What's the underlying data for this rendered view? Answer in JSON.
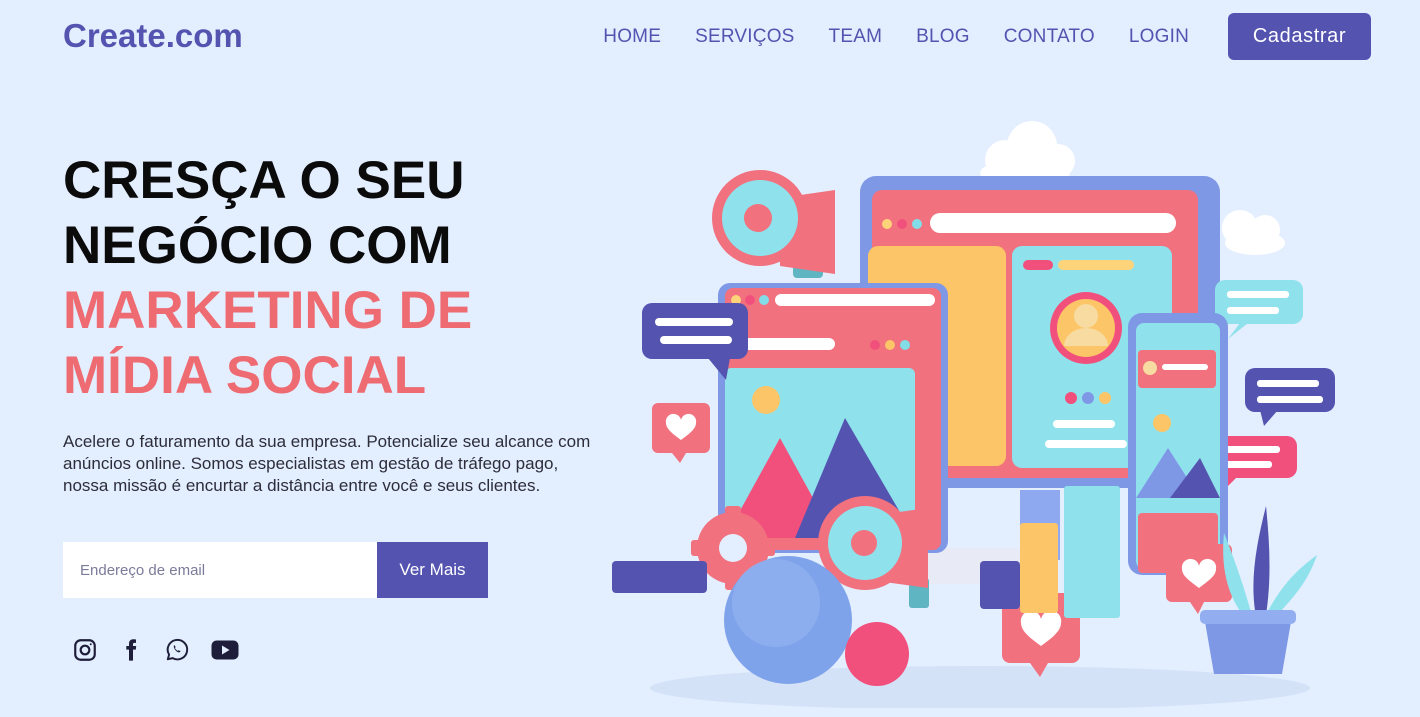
{
  "brand": {
    "logo": "Create.com"
  },
  "nav": {
    "items": [
      "HOME",
      "SERVIÇOS",
      "TEAM",
      "BLOG",
      "CONTATO",
      "LOGIN"
    ],
    "cta": "Cadastrar"
  },
  "hero": {
    "title_line1": "CRESÇA O SEU",
    "title_line2": "NEGÓCIO COM",
    "title_line3": "MARKETING DE",
    "title_line4": "MÍDIA SOCIAL",
    "description": "Acelere o faturamento da sua empresa. Potencialize seu alcance com anúncios online. Somos especialistas em gestão de tráfego pago, nossa missão é encurtar a distância entre você e seus clientes.",
    "email_placeholder": "Endereço de email",
    "email_value": "",
    "cta": "Ver Mais"
  },
  "social": {
    "icons": [
      "instagram-icon",
      "facebook-icon",
      "whatsapp-icon",
      "youtube-icon"
    ]
  },
  "colors": {
    "background": "#e3eeff",
    "primary": "#5453b0",
    "accent": "#ee6b72",
    "title": "#0b0b0b"
  }
}
